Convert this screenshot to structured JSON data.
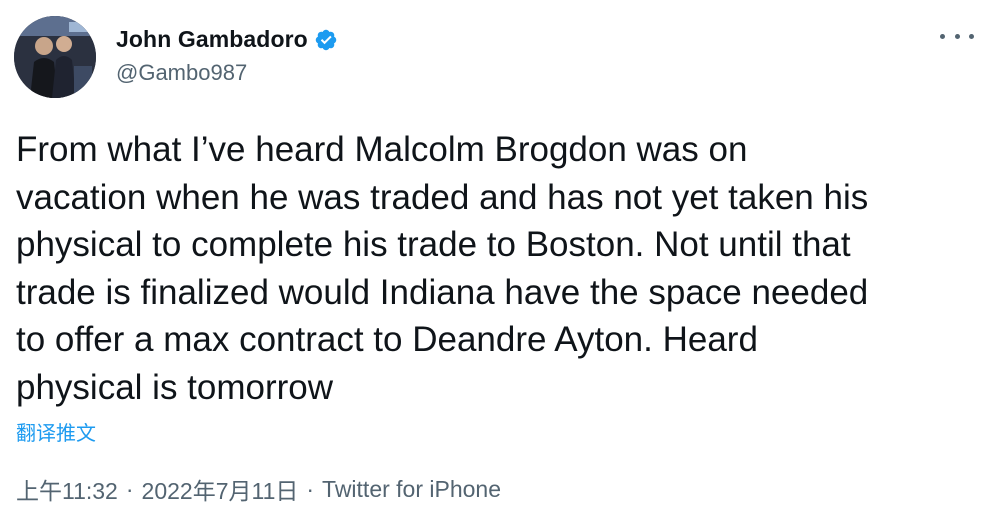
{
  "author": {
    "display_name": "John Gambadoro",
    "handle": "@Gambo987",
    "verified": true
  },
  "tweet": {
    "text": "From what I’ve heard Malcolm Brogdon was on\nvacation when he was traded and has not yet taken his\nphysical to complete his trade to Boston. Not until that\ntrade is finalized would Indiana have the space needed\nto offer a max contract to Deandre Ayton. Heard\nphysical is tomorrow",
    "translate_label": "翻译推文"
  },
  "meta": {
    "time": "上午11:32",
    "separator": "·",
    "date": "2022年7月11日",
    "source": "Twitter for iPhone"
  },
  "colors": {
    "link": "#1d9bf0",
    "secondary": "#536471",
    "text": "#0f1419"
  },
  "icons": {
    "verified": "verified-badge-icon",
    "more": "more-options-icon"
  }
}
